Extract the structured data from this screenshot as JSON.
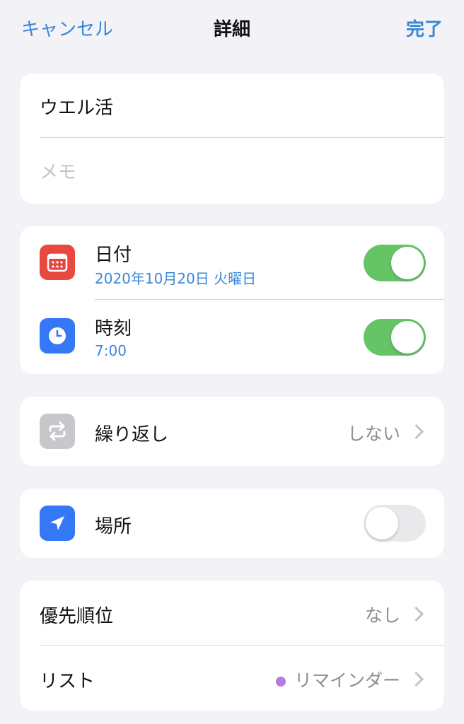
{
  "nav": {
    "cancel": "キャンセル",
    "title": "詳細",
    "done": "完了"
  },
  "task": {
    "title": "ウエル活",
    "memo_placeholder": "メモ"
  },
  "schedule": {
    "date_label": "日付",
    "date_value": "2020年10月20日 火曜日",
    "date_toggle": true,
    "time_label": "時刻",
    "time_value": "7:00",
    "time_toggle": true
  },
  "repeat": {
    "label": "繰り返し",
    "value": "しない"
  },
  "location": {
    "label": "場所",
    "toggle": false
  },
  "meta": {
    "priority_label": "優先順位",
    "priority_value": "なし",
    "list_label": "リスト",
    "list_value": "リマインダー",
    "list_color": "#b67be0"
  },
  "colors": {
    "accent": "#3a87d6",
    "toggle_on": "#65c466",
    "calendar_icon": "#e8483d",
    "clock_icon": "#3478f6",
    "repeat_icon": "#c7c7cc",
    "location_icon": "#3478f6"
  }
}
